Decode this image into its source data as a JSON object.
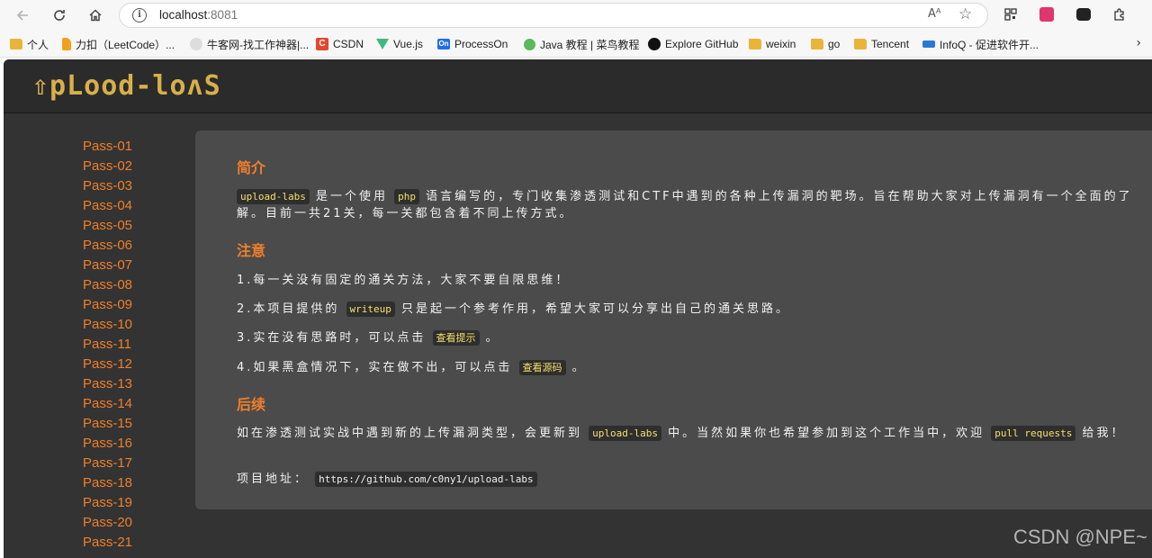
{
  "browser": {
    "url_host": "localhost",
    "url_port": ":8081",
    "read_aloud_label": "Aᴬ",
    "bookmarks": [
      {
        "label": "个人",
        "icon": "folder-icon"
      },
      {
        "label": "力扣（LeetCode）...",
        "icon": "leetcode-icon"
      },
      {
        "label": "牛客网-找工作神器|...",
        "icon": "nowcoder-icon"
      },
      {
        "label": "CSDN",
        "icon": "csdn-icon"
      },
      {
        "label": "Vue.js",
        "icon": "vue-icon"
      },
      {
        "label": "ProcessOn",
        "icon": "processon-icon"
      },
      {
        "label": "Java 教程 | 菜鸟教程",
        "icon": "runoob-icon"
      },
      {
        "label": "Explore GitHub",
        "icon": "github-icon"
      },
      {
        "label": "weixin",
        "icon": "folder-icon"
      },
      {
        "label": "go",
        "icon": "folder-icon"
      },
      {
        "label": "Tencent",
        "icon": "folder-icon"
      },
      {
        "label": "InfoQ - 促进软件开...",
        "icon": "infoq-icon"
      }
    ],
    "csdn_icon_text": "C",
    "processon_icon_text": "On"
  },
  "app": {
    "logo": "⇧pLood-loʌS"
  },
  "sidebar": {
    "items": [
      "Pass-01",
      "Pass-02",
      "Pass-03",
      "Pass-04",
      "Pass-05",
      "Pass-06",
      "Pass-07",
      "Pass-08",
      "Pass-09",
      "Pass-10",
      "Pass-11",
      "Pass-12",
      "Pass-13",
      "Pass-14",
      "Pass-15",
      "Pass-16",
      "Pass-17",
      "Pass-18",
      "Pass-19",
      "Pass-20",
      "Pass-21"
    ]
  },
  "main": {
    "intro_title": "简介",
    "intro_code": "upload-labs",
    "intro_t1": " 是一个使用 ",
    "intro_code2": "php",
    "intro_t2": " 语言编写的，专门收集渗透测试和CTF中遇到的各种上传漏洞的靶场。旨在帮助大家对上传漏洞有一个全面的了解。目前一共21关，每一关都包含着不同上传方式。",
    "notice_title": "注意",
    "note1": "1.每一关没有固定的通关方法，大家不要自限思维！",
    "note2_a": "2.本项目提供的 ",
    "note2_code": "writeup",
    "note2_b": " 只是起一个参考作用，希望大家可以分享出自己的通关思路。",
    "note3_a": "3.实在没有思路时，可以点击 ",
    "note3_link": "查看提示",
    "note3_b": " 。",
    "note4_a": "4.如果黑盒情况下，实在做不出，可以点击 ",
    "note4_link": "查看源码",
    "note4_b": " 。",
    "followup_title": "后续",
    "followup_a": "如在渗透测试实战中遇到新的上传漏洞类型，会更新到 ",
    "followup_code": "upload-labs",
    "followup_b": " 中。当然如果你也希望参加到这个工作当中，欢迎 ",
    "followup_code2": "pull requests",
    "followup_c": " 给我！",
    "repo_label": "项目地址：",
    "repo_url": "https://github.com/c0ny1/upload-labs"
  },
  "watermark": "CSDN @NPE~",
  "colors": {
    "accent_orange": "#f07f2b",
    "logo_gold": "#d8b04a",
    "page_bg": "#333333",
    "panel_bg": "#4b4b4b"
  }
}
